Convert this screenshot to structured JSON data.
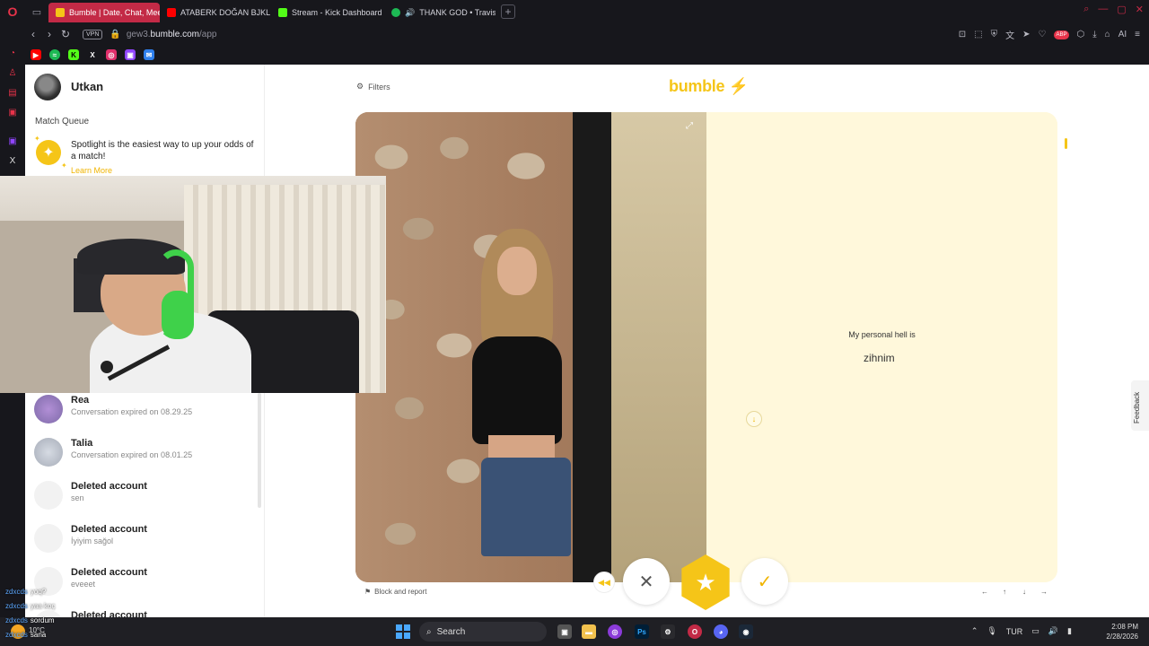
{
  "browser": {
    "tabs": [
      {
        "label": "Bumble | Date, Chat, Meet",
        "active": true,
        "color": "#f5c518"
      },
      {
        "label": "ATABERK DOĞAN BJKLI A",
        "active": false,
        "color": "#ff0000"
      },
      {
        "label": "Stream - Kick Dashboard",
        "active": false,
        "color": "#53fc18"
      },
      {
        "label": "THANK GOD • Travis S",
        "active": false,
        "color": "#1db954"
      }
    ],
    "url_prefix": "gew3.",
    "url_domain": "bumble.com",
    "url_path": "/app",
    "vpn_label": "VPN",
    "ai_label": "AI",
    "abp_label": "ABP"
  },
  "profile": {
    "name": "Utkan"
  },
  "match_queue": {
    "title": "Match Queue",
    "spotlight_text": "Spotlight is the easiest way to up your odds of a match!",
    "learn_more": "Learn More"
  },
  "matches": [
    {
      "name": "Rea",
      "subtitle": "Conversation expired on 08.29.25"
    },
    {
      "name": "Talia",
      "subtitle": "Conversation expired on 08.01.25"
    },
    {
      "name": "Deleted account",
      "subtitle": "sen"
    },
    {
      "name": "Deleted account",
      "subtitle": "İyiyim sağol"
    },
    {
      "name": "Deleted account",
      "subtitle": "eveeet"
    },
    {
      "name": "Deleted account",
      "subtitle": ""
    }
  ],
  "main": {
    "filters_label": "Filters",
    "logo_text": "bumble",
    "prompt_label": "My personal hell is",
    "prompt_answer": "zihnim",
    "block_report": "Block and report",
    "feedback": "Feedback"
  },
  "chat": [
    {
      "user": "zdxcds",
      "msg": "yoq?"
    },
    {
      "user": "zdxcds",
      "msg": "yaa koç"
    },
    {
      "user": "zdxcds",
      "msg": "sordum"
    },
    {
      "user": "zdxcds",
      "msg": "sana"
    }
  ],
  "taskbar": {
    "weather": "10°C",
    "search_label": "Search",
    "language": "TUR",
    "time": "2:08 PM",
    "date": "2/28/2026"
  },
  "colors": {
    "bumble_yellow": "#f5c518",
    "browser_accent": "#c32a46",
    "prompt_bg": "#fff8db"
  }
}
